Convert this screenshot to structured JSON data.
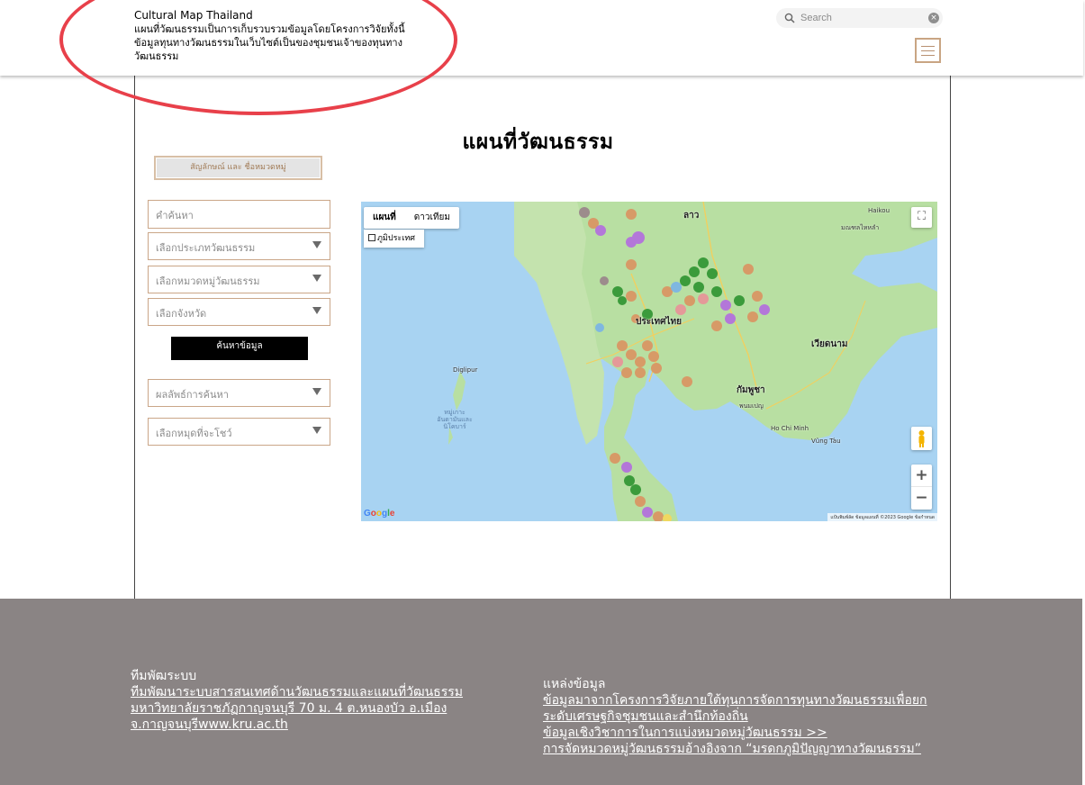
{
  "header": {
    "site_title": "Cultural Map Thailand",
    "site_description": "แผนที่วัฒนธรรมเป็นการเก็บรวบรวมข้อมูลโดยโครงการวิจัยทั้งนี้ข้อมูลทุนทางวัฒนธรรมในเว็บไซต์เป็นของชุมชนเจ้าของทุนทางวัฒนธรรม",
    "search_placeholder": "Search",
    "menu_icon": "hamburger-icon"
  },
  "main": {
    "page_title": "แผนที่วัฒนธรรม",
    "legend_button": "สัญลักษณ์ และ ชื่อหมวดหมู่",
    "keyword_placeholder": "คำค้นหา",
    "select_type": "เลือกประเภทวัฒนธรรม",
    "select_category": "เลือกหมวดหมู่วัฒนธรรม",
    "select_province": "เลือกจังหวัด",
    "search_button": "ค้นหาข้อมูล",
    "results": "ผลลัพธ์การค้นหา",
    "select_pin": "เลือกหมุดที่จะโชว์"
  },
  "map": {
    "type_map": "แผนที่",
    "type_satellite": "ดาวเทียม",
    "terrain": "ภูมิประเทศ",
    "zoom_in": "+",
    "zoom_out": "−",
    "logo": "Google",
    "attribution": "แป้นพิมพ์ลัด   ข้อมูลแผนที่ ©2023 Google   ข้อกำหนด",
    "labels": {
      "laos": "ลาว",
      "thailand": "ประเทศไทย",
      "cambodia": "กัมพูชา",
      "vietnam": "เวียดนาม",
      "phnom_penh": "พนมเปญ",
      "hcmc": "Ho Chi Minh",
      "haikou": "Haikou",
      "hainan": "มณฑลไหหลำ",
      "andaman": "หมู่เกาะอันดามันและนิโคบาร์",
      "digilpur": "Diglipur",
      "vung_tau": "Vũng Tàu"
    }
  },
  "footer": {
    "left_heading": "ทีมพัฒระบบ",
    "left_link": "ทีมพัฒนาระบบสารสนเทศด้านวัฒนธรรมและแผนที่วัฒนธรรมมหาวิทยาลัยราชภัฏกาญจนบุรี 70 ม. 4 ต.หนองบัว อ.เมือง จ.กาญจนบุรีwww.kru.ac.th",
    "right_heading": "แหล่งข้อมูล",
    "right_link_1": "ข้อมูลมาจากโครงการวิจัยภายใต้ทุนการจัดการทุนทางวัฒนธรรมเพื่อยกระดับเศรษฐกิจชุมชนและสำนึกท้องถิ่น",
    "right_link_2": "ข้อมูลเชิงวิชาการในการแบ่งหมวดหมู่วัฒนธรรม >>",
    "right_link_3": "การจัดหมวดหมู่วัฒนธรรมอ้างอิงจาก “มรดกภูมิปัญญาทางวัฒนธรรม”"
  },
  "colors": {
    "highlight_ellipse": "#e8404a",
    "field_border": "#caa688",
    "footer_bg": "#8a8484",
    "map_water": "#a8d3f2",
    "map_land": "#b8dfa2"
  }
}
